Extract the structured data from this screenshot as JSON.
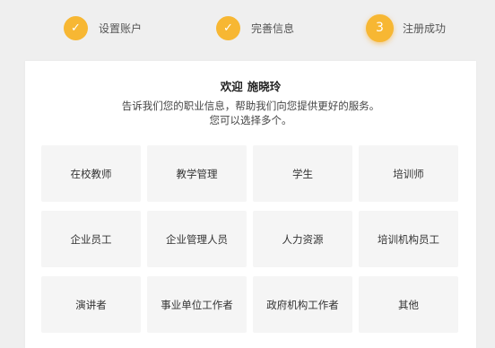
{
  "steps": [
    {
      "label": "设置账户",
      "icon": "check-icon",
      "mark": "✓"
    },
    {
      "label": "完善信息",
      "icon": "check-icon",
      "mark": "✓"
    },
    {
      "label": "注册成功",
      "number": "3"
    }
  ],
  "colors": {
    "accent": "#f7b733",
    "background": "#efefef",
    "tile": "#f5f5f5"
  },
  "card": {
    "welcome_prefix": "欢迎",
    "user_name": "施晓玲",
    "desc_line1": "告诉我们您的职业信息，帮助我们向您提供更好的服务。",
    "desc_line2": "您可以选择多个。"
  },
  "roles": [
    "在校教师",
    "教学管理",
    "学生",
    "培训师",
    "企业员工",
    "企业管理人员",
    "人力资源",
    "培训机构员工",
    "演讲者",
    "事业单位工作者",
    "政府机构工作者",
    "其他"
  ]
}
